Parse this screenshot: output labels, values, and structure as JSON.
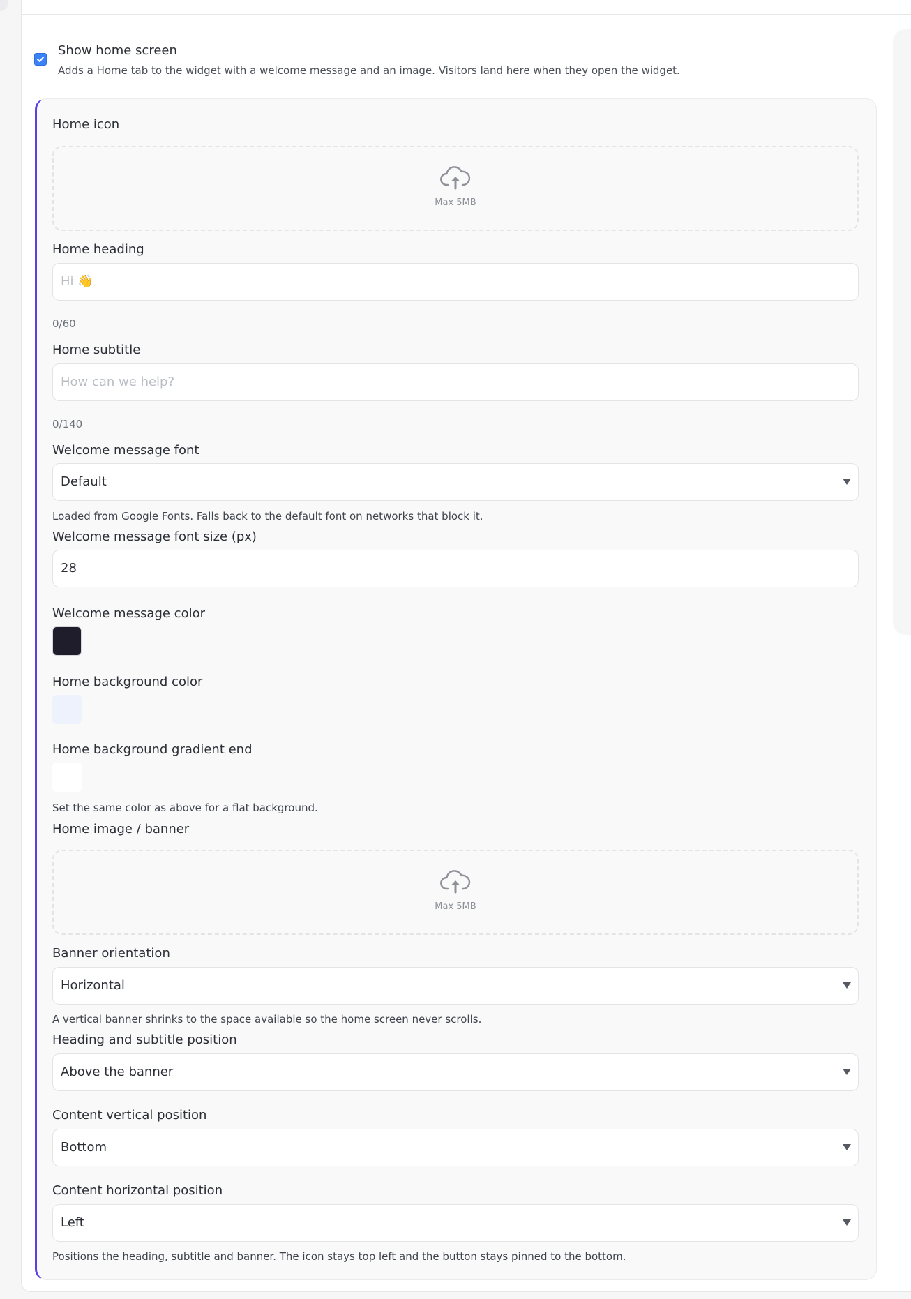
{
  "toggle": {
    "checked": true,
    "label": "Show home screen",
    "description": "Adds a Home tab to the widget with a welcome message and an image. Visitors land here when they open the widget."
  },
  "home_icon": {
    "label": "Home icon",
    "upload_hint": "Max 5MB",
    "icon": "cloud-upload-icon"
  },
  "home_heading": {
    "label": "Home heading",
    "placeholder": "Hi 👋",
    "value": "",
    "counter": "0/60"
  },
  "home_subtitle": {
    "label": "Home subtitle",
    "placeholder": "How can we help?",
    "value": "",
    "counter": "0/140"
  },
  "welcome_font": {
    "label": "Welcome message font",
    "selected": "Default",
    "help": "Loaded from Google Fonts. Falls back to the default font on networks that block it."
  },
  "welcome_font_size": {
    "label": "Welcome message font size (px)",
    "value": "28"
  },
  "welcome_color": {
    "label": "Welcome message color",
    "color": "#1f1d2b"
  },
  "home_bg_color": {
    "label": "Home background color",
    "color": "#eef2fc"
  },
  "home_bg_gradient_end": {
    "label": "Home background gradient end",
    "color": "#ffffff",
    "help": "Set the same color as above for a flat background."
  },
  "home_image": {
    "label": "Home image / banner",
    "upload_hint": "Max 5MB",
    "icon": "cloud-upload-icon"
  },
  "banner_orientation": {
    "label": "Banner orientation",
    "selected": "Horizontal",
    "help": "A vertical banner shrinks to the space available so the home screen never scrolls."
  },
  "heading_position": {
    "label": "Heading and subtitle position",
    "selected": "Above the banner"
  },
  "content_vertical": {
    "label": "Content vertical position",
    "selected": "Bottom"
  },
  "content_horizontal": {
    "label": "Content horizontal position",
    "selected": "Left",
    "help": "Positions the heading, subtitle and banner. The icon stays top left and the button stays pinned to the bottom."
  },
  "colors": {
    "accent": "#5b3ee6",
    "checkbox": "#3b82f6"
  }
}
